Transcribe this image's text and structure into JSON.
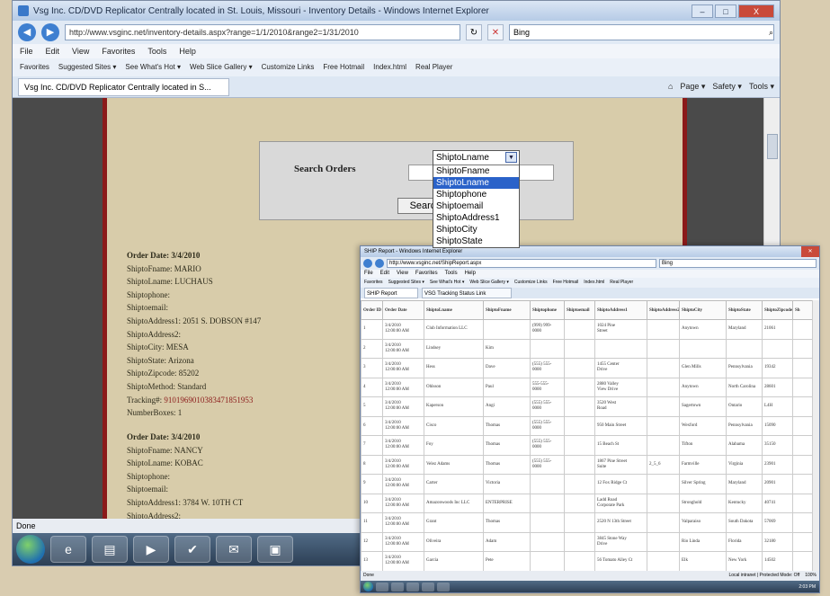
{
  "main_window": {
    "title": "Vsg Inc. CD/DVD Replicator Centrally located in St. Louis, Missouri - Inventory Details - Windows Internet Explorer",
    "url": "http://www.vsginc.net/inventory-details.aspx?range=1/1/2010&range2=1/31/2010",
    "search_label": "Bing",
    "menu": [
      "File",
      "Edit",
      "View",
      "Favorites",
      "Tools",
      "Help"
    ],
    "favorites": [
      "Favorites",
      "Suggested Sites ▾",
      "See What's Hot ▾",
      "Web Slice Gallery ▾",
      "Customize Links",
      "Free Hotmail",
      "Index.html",
      "Real Player"
    ],
    "tab_label": "Vsg Inc. CD/DVD Replicator Centrally located in S...",
    "commands": [
      "Page ▾",
      "Safety ▾",
      "Tools ▾"
    ],
    "status": "Done",
    "controls": {
      "min": "–",
      "max": "□",
      "close": "X"
    }
  },
  "search_panel": {
    "label": "Search Orders",
    "button": "Search",
    "selected": "ShiptoLname",
    "options": [
      "ShiptoFname",
      "ShiptoLname",
      "Shiptophone",
      "Shiptoemail",
      "ShiptoAddress1",
      "ShiptoCity",
      "ShiptoState"
    ]
  },
  "orders": [
    {
      "date": "Order Date: 3/4/2010",
      "fname": "ShiptoFname: MARIO",
      "lname": "ShiptoLname: LUCHAUS",
      "phone": "Shiptophone:",
      "email": "Shiptoemail:",
      "address1": "ShiptoAddress1: 2051 S. DOBSON #147",
      "address2": "ShiptoAddress2:",
      "city": "ShiptoCity: MESA",
      "state": "ShiptoState: Arizona",
      "zip": "ShiptoZipcode: 85202",
      "method": "ShiptoMethod: Standard",
      "tracking_label": "Tracking#:",
      "tracking": "9101969010383471851953",
      "boxes": "NumberBoxes: 1"
    },
    {
      "date": "Order Date: 3/4/2010",
      "fname": "ShiptoFname: NANCY",
      "lname": "ShiptoLname: KOBAC",
      "phone": "Shiptophone:",
      "email": "Shiptoemail:",
      "address1": "ShiptoAddress1: 3784 W. 10TH CT",
      "address2": "ShiptoAddress2:"
    }
  ],
  "second_window": {
    "title": "SHIP Report - Windows Internet Explorer",
    "url": "http://www.vsginc.net/ShipReport.aspx",
    "search_label": "Bing",
    "menu": [
      "File",
      "Edit",
      "View",
      "Favorites",
      "Tools",
      "Help"
    ],
    "favorites": [
      "Favorites",
      "Suggested Sites ▾",
      "See What's Hot ▾",
      "Web Slice Gallery ▾",
      "Customize Links",
      "Free Hotmail",
      "Index.html",
      "Real Player"
    ],
    "tabs": [
      "SHIP Report",
      "VSG Tracking Status Link"
    ],
    "status_left": "Done",
    "status_right": "Local intranet | Protected Mode: Off",
    "zoom": "100%",
    "clock": "2:03 PM",
    "columns": [
      "Order ID",
      "Order Date",
      "ShiptoLname",
      "ShiptoFname",
      "Shiptophone",
      "Shiptoemail",
      "ShiptoAddress1",
      "ShiptoAddress2",
      "ShiptoCity",
      "ShiptoState",
      "ShiptoZipcode",
      "Sh"
    ],
    "rows": [
      [
        "1",
        "3/4/2010\n12:00:00 AM",
        "Club Information LLC",
        "",
        "(999) 999-\n0000",
        "",
        "1024 Pine\nStreet",
        "",
        "Anytown",
        "Maryland",
        "21061",
        ""
      ],
      [
        "2",
        "3/4/2010\n12:00:00 AM",
        "Lindsey",
        "Kim",
        "",
        "",
        "",
        "",
        "",
        "",
        "",
        ""
      ],
      [
        "3",
        "3/4/2010\n12:00:00 AM",
        "Hess",
        "Dave",
        "(555) 555-\n0000",
        "",
        "1455 Center\nDrive",
        "",
        "Glen Mills",
        "Pennsylvania",
        "19342",
        ""
      ],
      [
        "4",
        "3/4/2010\n12:00:00 AM",
        "Ohlsson",
        "Paul",
        "555-555-\n0000",
        "",
        "2880 Valley\nView Drive",
        "",
        "Anytown",
        "North Carolina",
        "28601",
        ""
      ],
      [
        "5",
        "3/4/2010\n12:00:00 AM",
        "Kaperson",
        "Angi",
        "(555) 555-\n0000",
        "",
        "3520 West\nRoad",
        "",
        "Sagertown",
        "Ontario",
        "L4H",
        ""
      ],
      [
        "6",
        "3/4/2010\n12:00:00 AM",
        "Cisco",
        "Thomas",
        "(555) 555-\n0000",
        "",
        "950 Main Street",
        "",
        "Wexford",
        "Pennsylvania",
        "15090",
        ""
      ],
      [
        "7",
        "3/4/2010\n12:00:00 AM",
        "Foy",
        "Thomas",
        "(555) 555-\n0000",
        "",
        "15 Beach St",
        "",
        "Tifton",
        "Alabama",
        "35150",
        ""
      ],
      [
        "8",
        "3/4/2010\n12:00:00 AM",
        "Velez Adams",
        "Thomas",
        "(555) 555-\n0000",
        "",
        "1867 Pine Street\nSuite",
        "2_5_6",
        "Farmville",
        "Virginia",
        "23901",
        ""
      ],
      [
        "9",
        "3/4/2010\n12:00:00 AM",
        "Carter",
        "Victoria",
        "",
        "",
        "12 Fox Ridge Ct",
        "",
        "Silver Spring",
        "Maryland",
        "20901",
        ""
      ],
      [
        "10",
        "3/4/2010\n12:00:00 AM",
        "Amazonwoods Inc LLC",
        "ENTERPRISE",
        "",
        "",
        "Ladd Road\nCorporate Park",
        "",
        "Stronghold",
        "Kentucky",
        "40741",
        ""
      ],
      [
        "11",
        "3/4/2010\n12:00:00 AM",
        "Grant",
        "Thomas",
        "",
        "",
        "2520 N 13th Street",
        "",
        "Valparaiso",
        "South Dakota",
        "57069",
        ""
      ],
      [
        "12",
        "3/4/2010\n12:00:00 AM",
        "Oliveira",
        "Adam",
        "",
        "",
        "3845 Stone Way\nDrive",
        "",
        "Rio Linda",
        "Florida",
        "32180",
        ""
      ],
      [
        "13",
        "3/4/2010\n12:00:00 AM",
        "Garcia",
        "Pete",
        "",
        "",
        "56 Tomato Alley Ct",
        "",
        "Elk",
        "New York",
        "14502",
        ""
      ]
    ]
  },
  "colors": {
    "page_bg": "#d8ccaa",
    "page_border": "#8b1a1a",
    "highlight": "#2a62c9",
    "tracking": "#8b1a1a"
  }
}
